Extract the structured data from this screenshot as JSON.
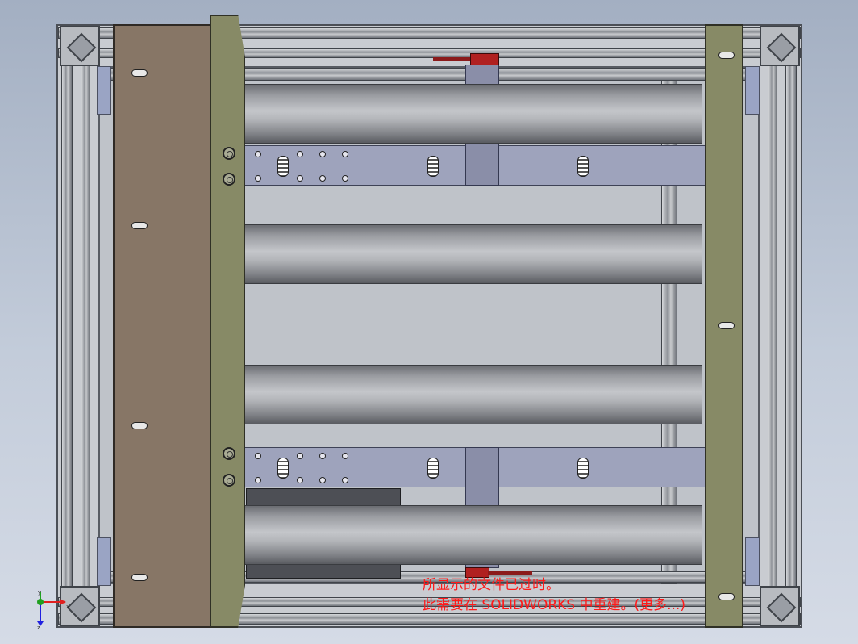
{
  "viewer": {
    "name": "SOLIDWORKS eDrawings viewport",
    "background_top": "#a3afc2",
    "background_bottom": "#d5dbe6"
  },
  "warning": {
    "line1": "所显示的文件已过时。",
    "line2": "此需要在 SOLIDWORKS 中重建。(更多...)",
    "color": "#ff1a1a"
  },
  "triad": {
    "x_axis": "x",
    "y_axis": "y",
    "z_axis": "z",
    "x_color": "#e02020",
    "y_color": "#20a020",
    "z_color": "#2020e0"
  },
  "colors": {
    "frame": "#c9ccd1",
    "left_plate": "#877666",
    "side_plate": "#878a66",
    "roller": "#b3b5b9",
    "beam": "#9ea3bc",
    "handle": "#b02020"
  }
}
